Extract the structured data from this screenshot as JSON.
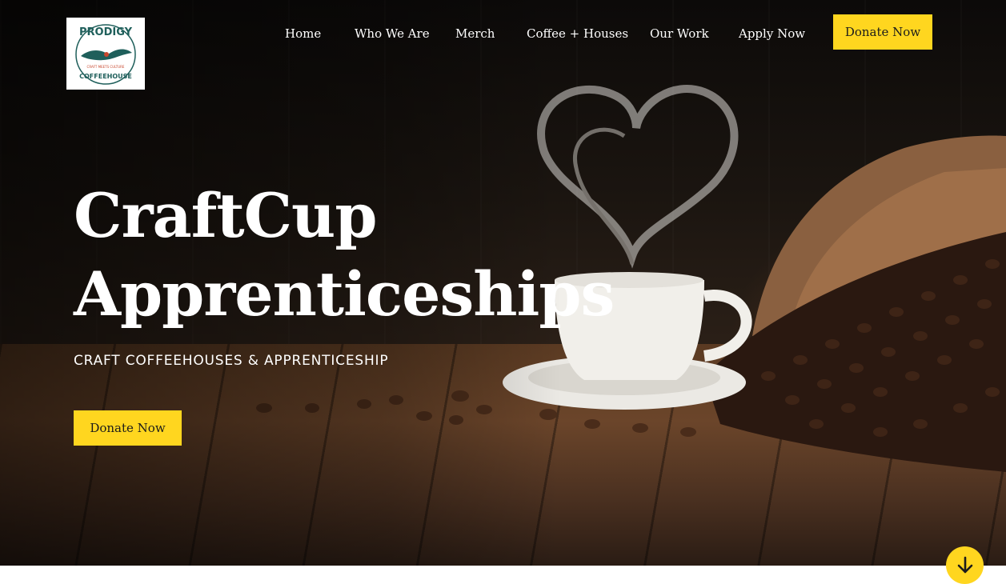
{
  "logo": {
    "brand": "PRODIGY",
    "tagline": "CRAFT MEETS CULTURE",
    "subbrand": "COFFEEHOUSE"
  },
  "nav": {
    "items": [
      {
        "label": "Home"
      },
      {
        "label": "Who We Are"
      },
      {
        "label": "Merch"
      },
      {
        "label": "Coffee + Houses"
      },
      {
        "label": "Our Work"
      },
      {
        "label": "Apply Now"
      }
    ],
    "donate_label": "Donate Now"
  },
  "hero": {
    "title_line1": "CraftCup",
    "title_line2": "Apprenticeships",
    "subtitle": "CRAFT COFFEEHOUSES & APPRENTICESHIP",
    "donate_label": "Donate Now"
  },
  "scroll": {
    "icon": "arrow-down-icon"
  },
  "colors": {
    "accent": "#ffd61f",
    "logo_teal": "#1f5f5b",
    "logo_red": "#c8472d"
  }
}
